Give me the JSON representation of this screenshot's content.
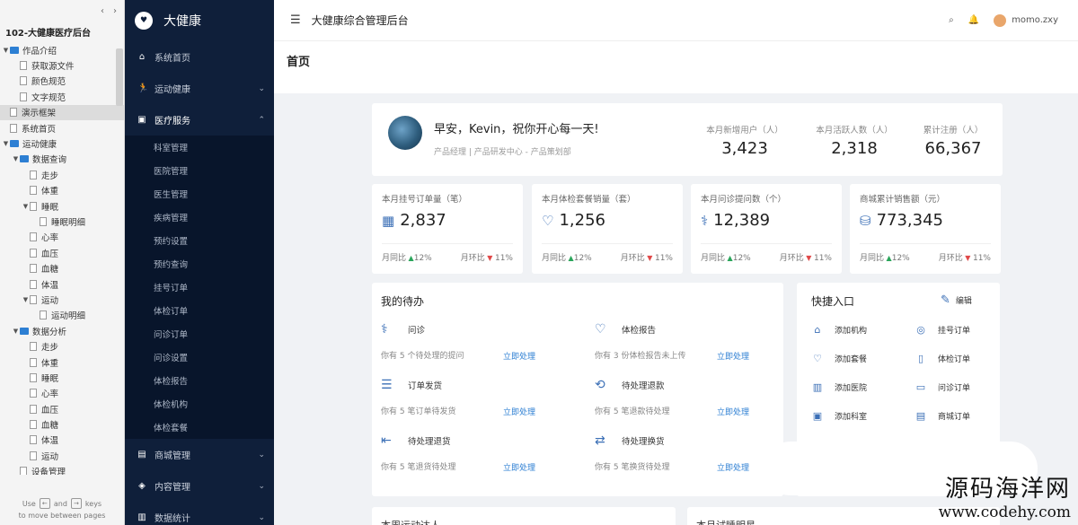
{
  "tree": {
    "project_title": "102-大健康医疗后台",
    "items": [
      {
        "label": "作品介绍",
        "level": 0,
        "type": "folder"
      },
      {
        "label": "获取源文件",
        "level": 1,
        "type": "page"
      },
      {
        "label": "颜色规范",
        "level": 1,
        "type": "page"
      },
      {
        "label": "文字规范",
        "level": 1,
        "type": "page"
      },
      {
        "label": "演示框架",
        "level": 0,
        "type": "page",
        "selected": true
      },
      {
        "label": "系统首页",
        "level": 0,
        "type": "page"
      },
      {
        "label": "运动健康",
        "level": 0,
        "type": "folder"
      },
      {
        "label": "数据查询",
        "level": 1,
        "type": "folder"
      },
      {
        "label": "走步",
        "level": 2,
        "type": "page"
      },
      {
        "label": "体重",
        "level": 2,
        "type": "page"
      },
      {
        "label": "睡眠",
        "level": 2,
        "type": "page",
        "expandable": true
      },
      {
        "label": "睡眠明细",
        "level": 3,
        "type": "page"
      },
      {
        "label": "心率",
        "level": 2,
        "type": "page"
      },
      {
        "label": "血压",
        "level": 2,
        "type": "page"
      },
      {
        "label": "血糖",
        "level": 2,
        "type": "page"
      },
      {
        "label": "体温",
        "level": 2,
        "type": "page"
      },
      {
        "label": "运动",
        "level": 2,
        "type": "page",
        "expandable": true
      },
      {
        "label": "运动明细",
        "level": 3,
        "type": "page"
      },
      {
        "label": "数据分析",
        "level": 1,
        "type": "folder"
      },
      {
        "label": "走步",
        "level": 2,
        "type": "page"
      },
      {
        "label": "体重",
        "level": 2,
        "type": "page"
      },
      {
        "label": "睡眠",
        "level": 2,
        "type": "page"
      },
      {
        "label": "心率",
        "level": 2,
        "type": "page"
      },
      {
        "label": "血压",
        "level": 2,
        "type": "page"
      },
      {
        "label": "血糖",
        "level": 2,
        "type": "page"
      },
      {
        "label": "体温",
        "level": 2,
        "type": "page"
      },
      {
        "label": "运动",
        "level": 2,
        "type": "page"
      },
      {
        "label": "设备管理",
        "level": 1,
        "type": "page"
      }
    ],
    "footer_use": "Use",
    "footer_and": "and",
    "footer_keys": "keys",
    "footer_move": "to move between pages"
  },
  "nav": {
    "brand": "大健康",
    "menus": [
      {
        "label": "系统首页",
        "icon": "home-icon",
        "glyph": "⌂"
      },
      {
        "label": "运动健康",
        "icon": "run-icon",
        "glyph": "🏃",
        "arrow": "⌄"
      },
      {
        "label": "医疗服务",
        "icon": "medkit-icon",
        "glyph": "▣",
        "arrow": "⌃",
        "open": true
      }
    ],
    "submenu": [
      "科室管理",
      "医院管理",
      "医生管理",
      "疾病管理",
      "预约设置",
      "预约查询",
      "挂号订单",
      "体检订单",
      "问诊订单",
      "问诊设置",
      "体检报告",
      "体检机构",
      "体检套餐"
    ],
    "menus_after": [
      {
        "label": "商城管理",
        "icon": "shop-icon",
        "glyph": "▤",
        "arrow": "⌄"
      },
      {
        "label": "内容管理",
        "icon": "content-icon",
        "glyph": "◈",
        "arrow": "⌄"
      },
      {
        "label": "数据统计",
        "icon": "stats-icon",
        "glyph": "▥",
        "arrow": "⌄"
      }
    ]
  },
  "header": {
    "title": "大健康综合管理后台",
    "username": "momo.zxy"
  },
  "page_title": "首页",
  "welcome": {
    "greeting": "早安，Kevin，祝你开心每一天!",
    "subtitle": "产品经理 | 产品研发中心 - 产品策划部",
    "stats": [
      {
        "label": "本月新增用户（人）",
        "value": "3,423"
      },
      {
        "label": "本月活跃人数（人）",
        "value": "2,318"
      },
      {
        "label": "累计注册（人）",
        "value": "66,367"
      }
    ]
  },
  "kpis": [
    {
      "label": "本月挂号订单量（笔）",
      "value": "2,837",
      "icon": "calendar-icon",
      "glyph": "▦",
      "yoy_label": "月同比",
      "yoy": "12%",
      "mom_label": "月环比",
      "mom": "11%"
    },
    {
      "label": "本月体检套餐销量（套）",
      "value": "1,256",
      "icon": "heart-check-icon",
      "glyph": "♡",
      "yoy_label": "月同比",
      "yoy": "12%",
      "mom_label": "月环比",
      "mom": "11%"
    },
    {
      "label": "本月问诊提问数（个）",
      "value": "12,389",
      "icon": "stethoscope-icon",
      "glyph": "⚕",
      "yoy_label": "月同比",
      "yoy": "12%",
      "mom_label": "月环比",
      "mom": "11%"
    },
    {
      "label": "商城累计销售额（元）",
      "value": "773,345",
      "icon": "coins-icon",
      "glyph": "⛁",
      "yoy_label": "月同比",
      "yoy": "12%",
      "mom_label": "月环比",
      "mom": "11%"
    }
  ],
  "todo": {
    "title": "我的待办",
    "items": [
      {
        "name": "问诊",
        "desc": "你有 5 个待处理的提问",
        "action": "立即处理",
        "icon": "stethoscope-icon",
        "glyph": "⚕"
      },
      {
        "name": "体检报告",
        "desc": "你有 3 份体检报告未上传",
        "action": "立即处理",
        "icon": "heart-check-icon",
        "glyph": "♡"
      },
      {
        "name": "订单发货",
        "desc": "你有 5 笔订单待发货",
        "action": "立即处理",
        "icon": "order-icon",
        "glyph": "☰"
      },
      {
        "name": "待处理退款",
        "desc": "你有 5 笔退款待处理",
        "action": "立即处理",
        "icon": "refund-icon",
        "glyph": "⟲"
      },
      {
        "name": "待处理退货",
        "desc": "你有 5 笔退货待处理",
        "action": "立即处理",
        "icon": "return-icon",
        "glyph": "⇤"
      },
      {
        "name": "待处理换货",
        "desc": "你有 5 笔换货待处理",
        "action": "立即处理",
        "icon": "exchange-icon",
        "glyph": "⇄"
      }
    ]
  },
  "quick": {
    "title": "快捷入口",
    "edit": "编辑",
    "items": [
      {
        "label": "添加机构",
        "icon": "institution-icon",
        "glyph": "⌂"
      },
      {
        "label": "挂号订单",
        "icon": "pin-icon",
        "glyph": "◎"
      },
      {
        "label": "添加套餐",
        "icon": "package-icon",
        "glyph": "♡"
      },
      {
        "label": "体检订单",
        "icon": "doc-icon",
        "glyph": "▯"
      },
      {
        "label": "添加医院",
        "icon": "hospital-icon",
        "glyph": "▥"
      },
      {
        "label": "问诊订单",
        "icon": "chat-icon",
        "glyph": "▭"
      },
      {
        "label": "添加科室",
        "icon": "department-icon",
        "glyph": "▣"
      },
      {
        "label": "商城订单",
        "icon": "mall-order-icon",
        "glyph": "▤"
      }
    ]
  },
  "bottom": {
    "left_title": "本周运动达人",
    "right_title": "本月试睡明星"
  },
  "watermark": {
    "line1": "源码海洋网",
    "line2": "www.codehy.com"
  }
}
